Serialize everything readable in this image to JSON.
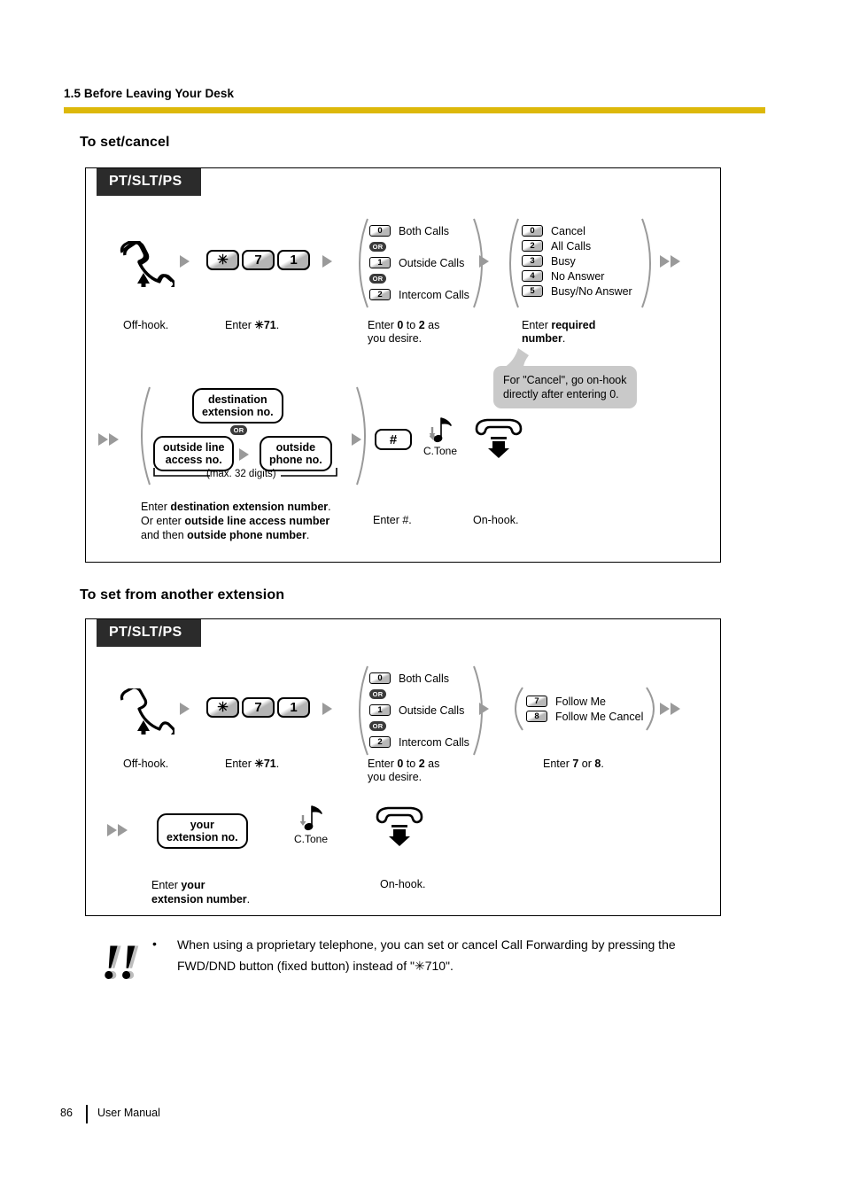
{
  "header": {
    "section": "1.5 Before Leaving Your Desk",
    "rule_color": "#ddb80a"
  },
  "sections": [
    {
      "heading": "To set/cancel",
      "device_tag": "PT/SLT/PS",
      "steps_row1": {
        "offhook_caption": "Off-hook.",
        "keys": [
          "✳",
          "7",
          "1"
        ],
        "keys_caption_prefix": "Enter ",
        "keys_caption_bold": "✳71",
        "keys_caption_suffix": ".",
        "group1": {
          "options": [
            {
              "key": "0",
              "label": "Both Calls"
            },
            {
              "key": "1",
              "label": "Outside Calls"
            },
            {
              "key": "2",
              "label": "Intercom Calls"
            }
          ],
          "or_label": "OR",
          "caption_line1_a": "Enter ",
          "caption_line1_b": "0",
          "caption_line1_c": " to ",
          "caption_line1_d": "2",
          "caption_line1_e": " as",
          "caption_line2": "you desire."
        },
        "group2": {
          "options": [
            {
              "key": "0",
              "label": "Cancel"
            },
            {
              "key": "2",
              "label": "All Calls"
            },
            {
              "key": "3",
              "label": "Busy"
            },
            {
              "key": "4",
              "label": "No Answer"
            },
            {
              "key": "5",
              "label": "Busy/No Answer"
            }
          ],
          "caption_line1_a": "Enter ",
          "caption_line1_b": "required",
          "caption_line2": "number",
          "caption_line2_suffix": "."
        },
        "bubble": {
          "line1": "For \"Cancel\", go on-hook",
          "line2": "directly after entering 0."
        }
      },
      "steps_row2": {
        "dest_box": {
          "line1": "destination",
          "line2": "extension no."
        },
        "or_label": "OR",
        "outside_line_box": {
          "line1": "outside line",
          "line2": "access no."
        },
        "outside_phone_box": {
          "line1": "outside",
          "line2": "phone no."
        },
        "max_digits": "(max. 32 digits)",
        "caption_line1_a": "Enter ",
        "caption_line1_b": "destination extension number",
        "caption_line1_c": ".",
        "caption_line2_a": "Or enter ",
        "caption_line2_b": "outside line access number",
        "caption_line3_a": "and then ",
        "caption_line3_b": "outside phone number",
        "caption_line3_c": ".",
        "hash_key": "#",
        "hash_caption": "Enter #.",
        "ctone_label": "C.Tone",
        "onhook_caption": "On-hook."
      }
    },
    {
      "heading": "To set from another extension",
      "device_tag": "PT/SLT/PS",
      "steps_row1": {
        "offhook_caption": "Off-hook.",
        "keys": [
          "✳",
          "7",
          "1"
        ],
        "keys_caption_prefix": "Enter ",
        "keys_caption_bold": "✳71",
        "keys_caption_suffix": ".",
        "group1": {
          "options": [
            {
              "key": "0",
              "label": "Both Calls"
            },
            {
              "key": "1",
              "label": "Outside Calls"
            },
            {
              "key": "2",
              "label": "Intercom Calls"
            }
          ],
          "or_label": "OR",
          "caption_line1_a": "Enter ",
          "caption_line1_b": "0",
          "caption_line1_c": " to ",
          "caption_line1_d": "2",
          "caption_line1_e": " as",
          "caption_line2": "you desire."
        },
        "group2": {
          "options": [
            {
              "key": "7",
              "label": "Follow Me"
            },
            {
              "key": "8",
              "label": "Follow Me Cancel"
            }
          ],
          "caption_a": "Enter ",
          "caption_b": "7",
          "caption_c": " or ",
          "caption_d": "8",
          "caption_e": "."
        }
      },
      "steps_row2": {
        "your_ext_box": {
          "line1": "your",
          "line2": "extension no."
        },
        "caption_line1_a": "Enter ",
        "caption_line1_b": "your",
        "caption_line2_a": "extension number",
        "caption_line2_b": ".",
        "ctone_label": "C.Tone",
        "onhook_caption": "On-hook."
      }
    }
  ],
  "note": {
    "bangs": "!!",
    "bullet": "•",
    "line1": "When using a proprietary telephone, you can set or cancel Call Forwarding by pressing the",
    "line2": "FWD/DND button (fixed button) instead of \"✳710\"."
  },
  "footer": {
    "page_number": "86",
    "label": "User Manual"
  }
}
